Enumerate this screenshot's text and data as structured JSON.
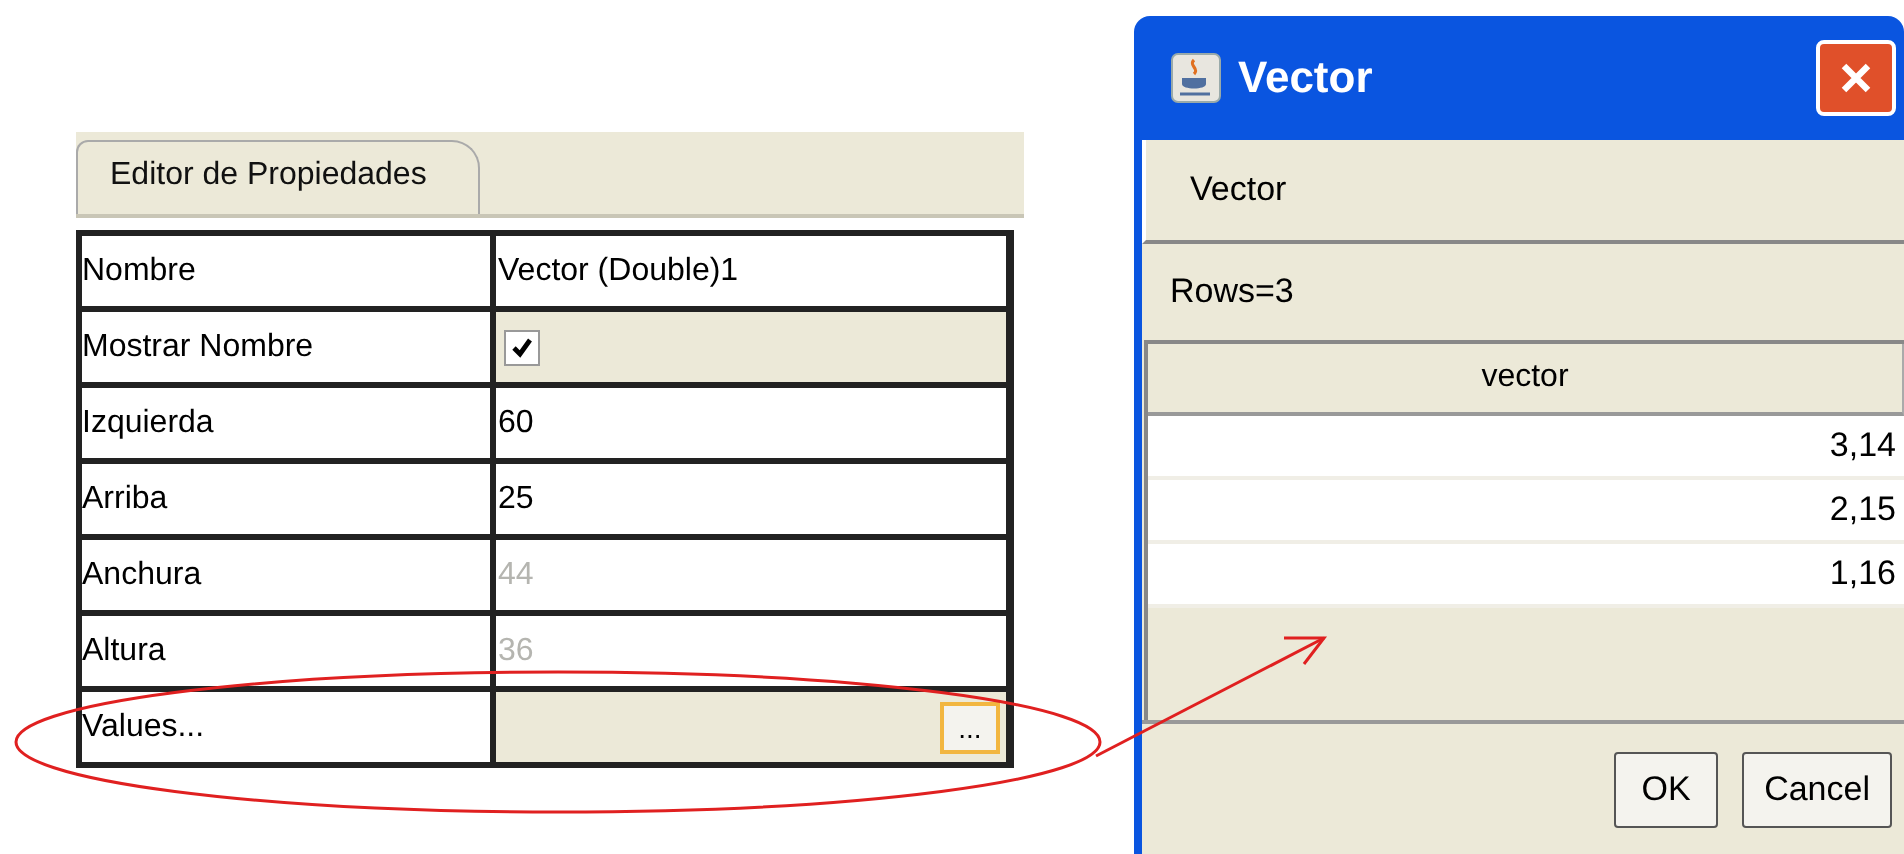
{
  "panel": {
    "tabs": [
      {
        "label": "Editor de Propiedades",
        "selected": true
      }
    ],
    "properties": [
      {
        "name": "Nombre",
        "kind": "text",
        "value": "Vector (Double)1",
        "disabled": false
      },
      {
        "name": "Mostrar Nombre",
        "kind": "checkbox",
        "checked": true
      },
      {
        "name": "Izquierda",
        "kind": "text",
        "value": "60",
        "disabled": false
      },
      {
        "name": "Arriba",
        "kind": "text",
        "value": "25",
        "disabled": false
      },
      {
        "name": "Anchura",
        "kind": "text",
        "value": "44",
        "disabled": true
      },
      {
        "name": "Altura",
        "kind": "text",
        "value": "36",
        "disabled": true
      },
      {
        "name": "Values...",
        "kind": "button",
        "button_label": "..."
      }
    ]
  },
  "dialog": {
    "title": "Vector",
    "header": "Vector",
    "rows_label": "Rows=3",
    "table": {
      "columns": [
        "vector"
      ],
      "rows": [
        [
          "3,14"
        ],
        [
          "2,15"
        ],
        [
          "1,16"
        ]
      ]
    },
    "buttons": [
      "OK",
      "Cancel"
    ]
  }
}
